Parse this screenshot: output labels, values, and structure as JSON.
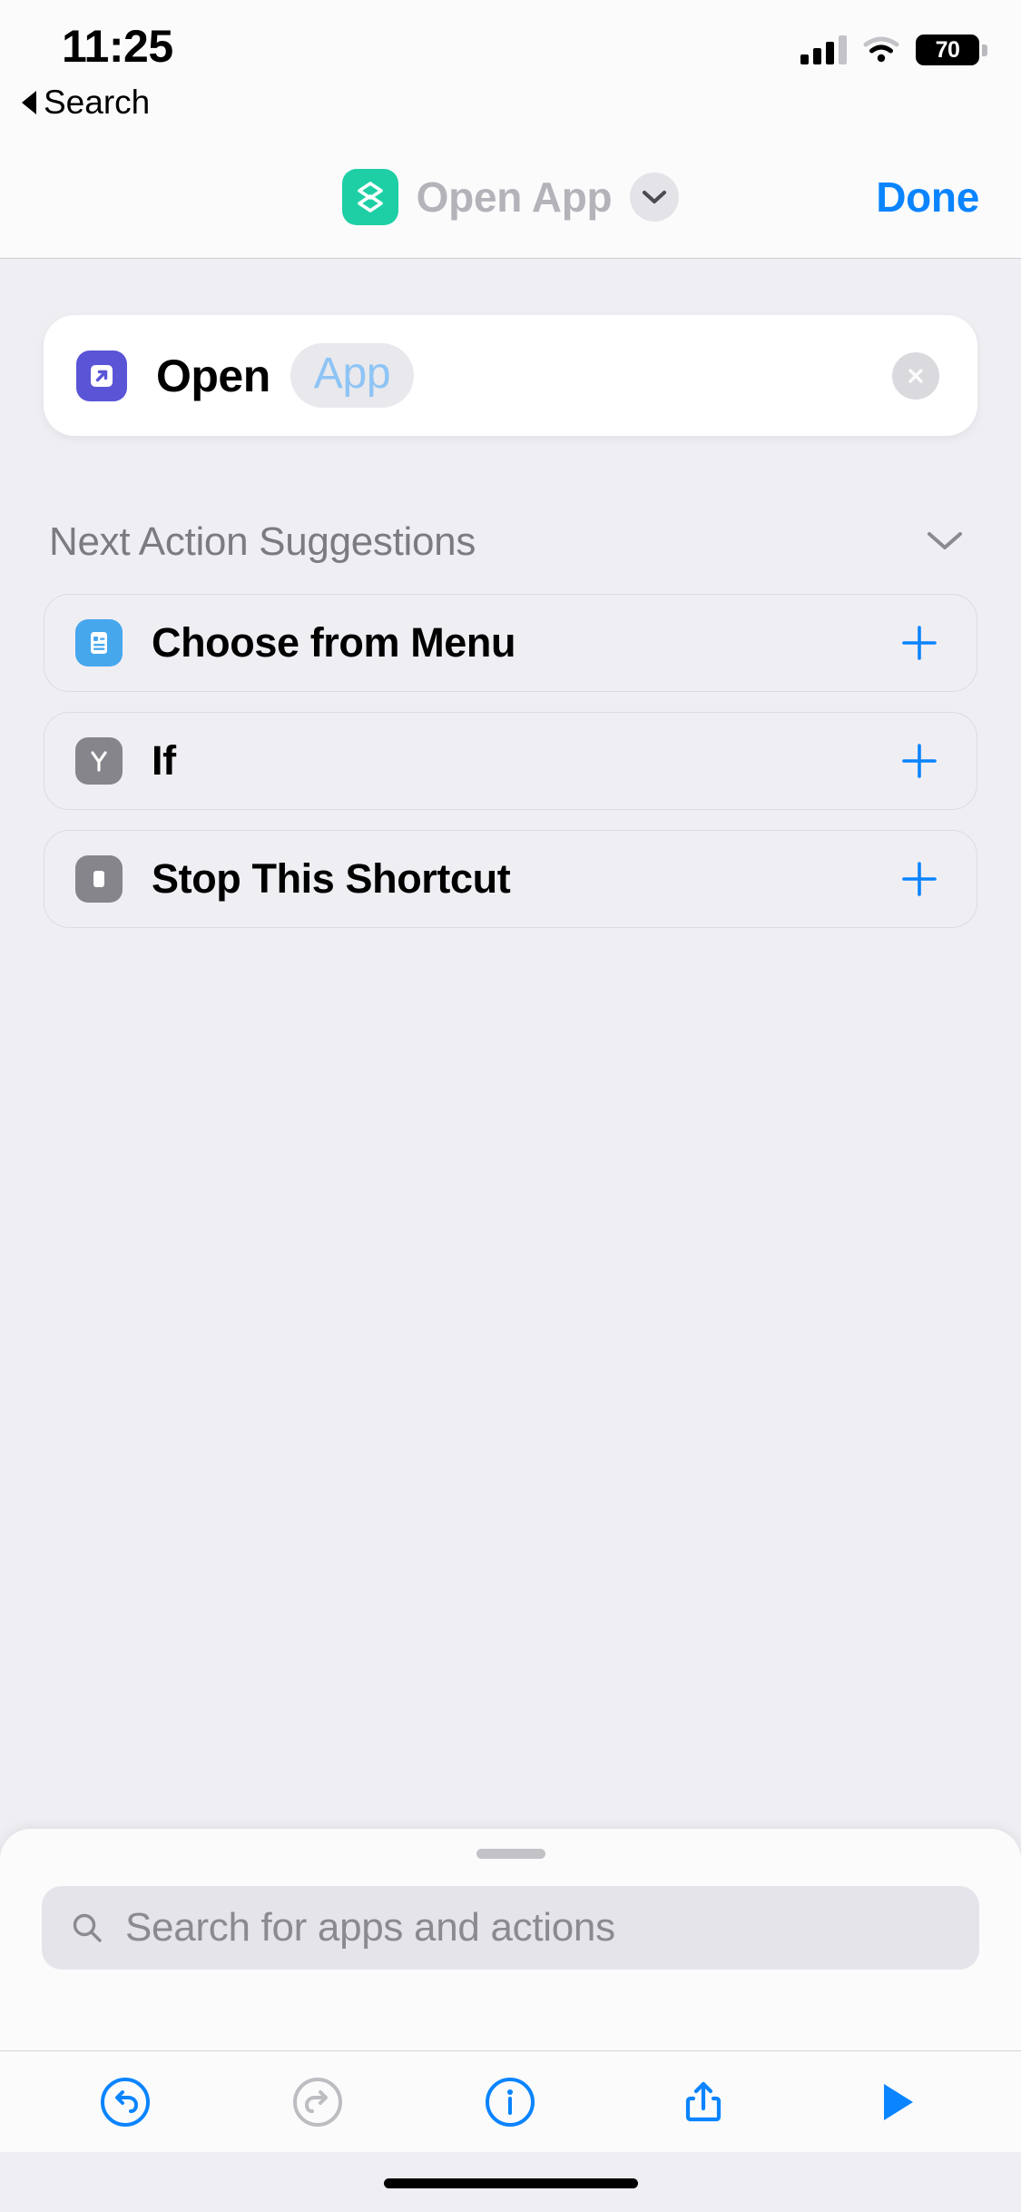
{
  "status_bar": {
    "time": "11:25",
    "back_label": "Search",
    "back_icon": "triangle-left-icon",
    "signal_icon": "cellular-bars-icon",
    "wifi_icon": "wifi-icon",
    "battery_percent": "70",
    "battery_icon": "battery-icon"
  },
  "nav_bar": {
    "app_icon": "shortcuts-layers-icon",
    "title": "Open App",
    "chevron_icon": "chevron-down-icon",
    "done_label": "Done",
    "accent_color": "#0a84ff",
    "shortcut_icon_color": "#1ecfa5",
    "title_color": "#b4b3b9"
  },
  "action_card": {
    "icon": "open-app-arrow-icon",
    "icon_color": "#5a55d6",
    "verb": "Open",
    "parameter": "App",
    "parameter_color": "#8ec4f5",
    "clear_icon": "close-circle-icon"
  },
  "suggestions": {
    "header_title": "Next Action Suggestions",
    "collapse_icon": "chevron-down-icon",
    "items": [
      {
        "label": "Choose from Menu",
        "icon": "menu-list-icon",
        "icon_color": "#46a7ed",
        "add_icon": "plus-icon"
      },
      {
        "label": "If",
        "icon": "branch-icon",
        "icon_color": "#85858b",
        "add_icon": "plus-icon"
      },
      {
        "label": "Stop This Shortcut",
        "icon": "stop-square-icon",
        "icon_color": "#85858b",
        "add_icon": "plus-icon"
      }
    ]
  },
  "sheet": {
    "grabber": "drag-handle",
    "search_icon": "search-icon",
    "search_value": "",
    "search_placeholder": "Search for apps and actions"
  },
  "toolbar": {
    "items": [
      {
        "name": "undo-button",
        "icon": "undo-icon",
        "color": "#0a84ff",
        "enabled": true
      },
      {
        "name": "redo-button",
        "icon": "redo-icon",
        "color": "#bcbcc1",
        "enabled": false
      },
      {
        "name": "info-button",
        "icon": "info-circle-icon",
        "color": "#0a84ff",
        "enabled": true
      },
      {
        "name": "share-button",
        "icon": "share-icon",
        "color": "#0a84ff",
        "enabled": true
      },
      {
        "name": "run-button",
        "icon": "play-icon",
        "color": "#0a84ff",
        "enabled": true
      }
    ]
  },
  "home_indicator": "home-indicator"
}
